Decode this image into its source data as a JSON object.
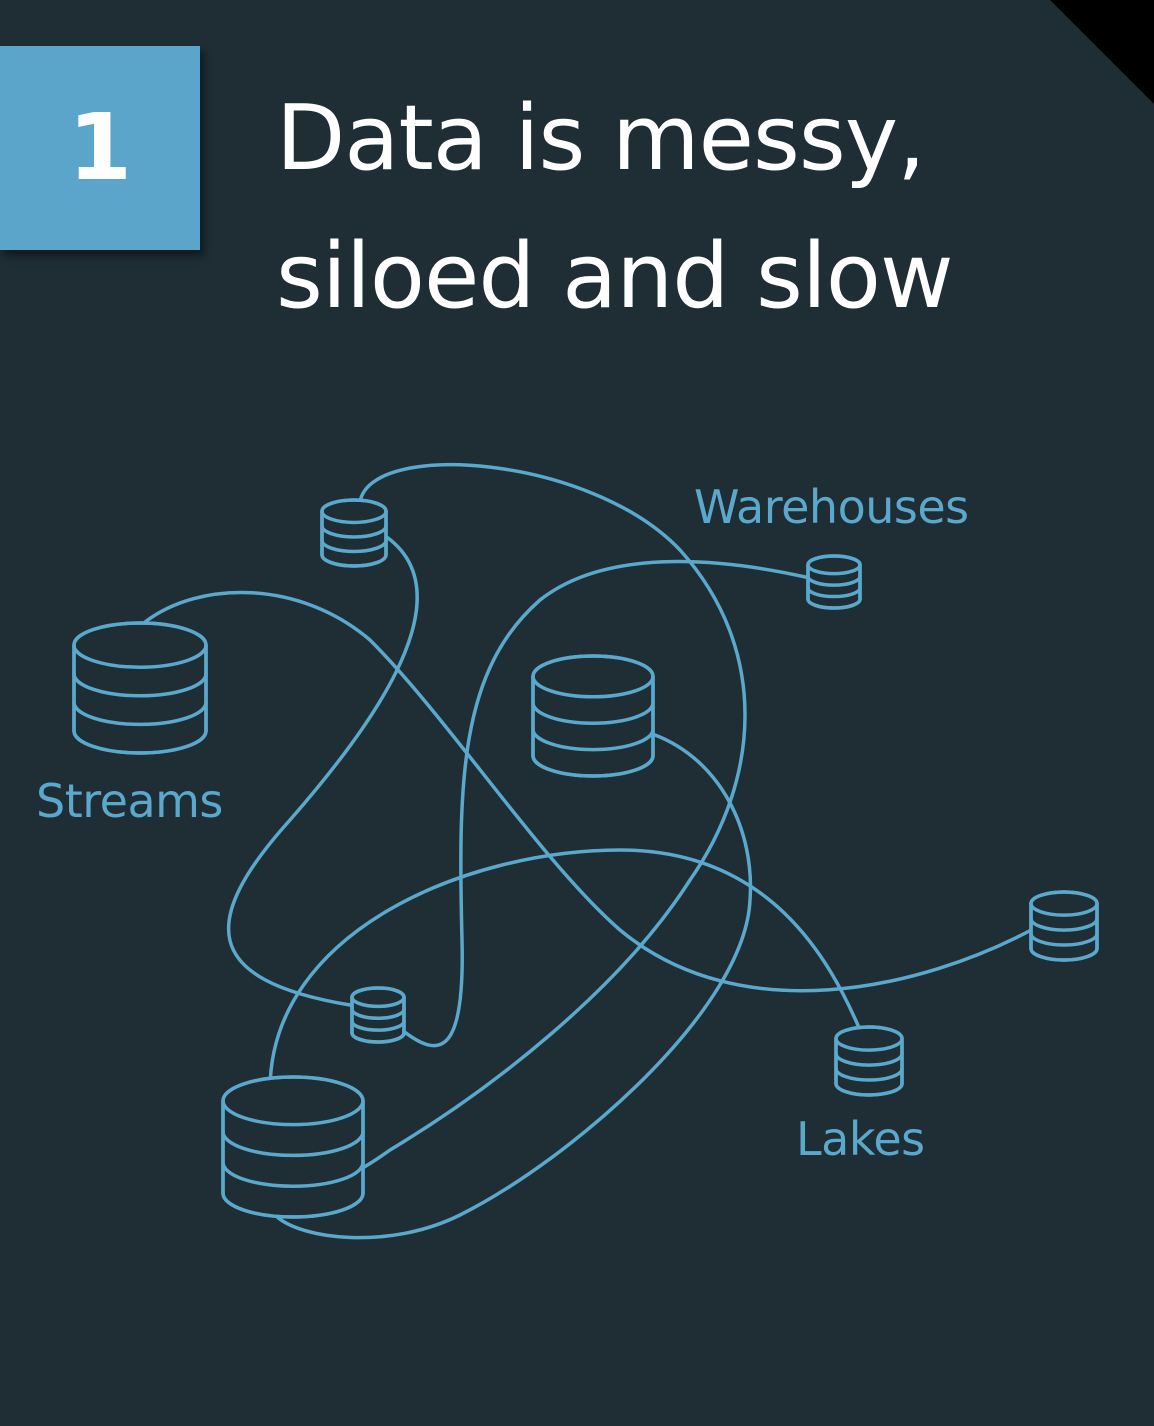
{
  "badge": {
    "number": "1"
  },
  "title": {
    "line1": "Data is messy,",
    "line2": "siloed and slow"
  },
  "labels": {
    "warehouses": "Warehouses",
    "streams": "Streams",
    "lakes": "Lakes"
  },
  "colors": {
    "card_background": "#1f2d35",
    "accent": "#5aa8cc",
    "badge": "#5aa5c9",
    "text": "#ffffff"
  },
  "icons": [
    "database-icon"
  ]
}
